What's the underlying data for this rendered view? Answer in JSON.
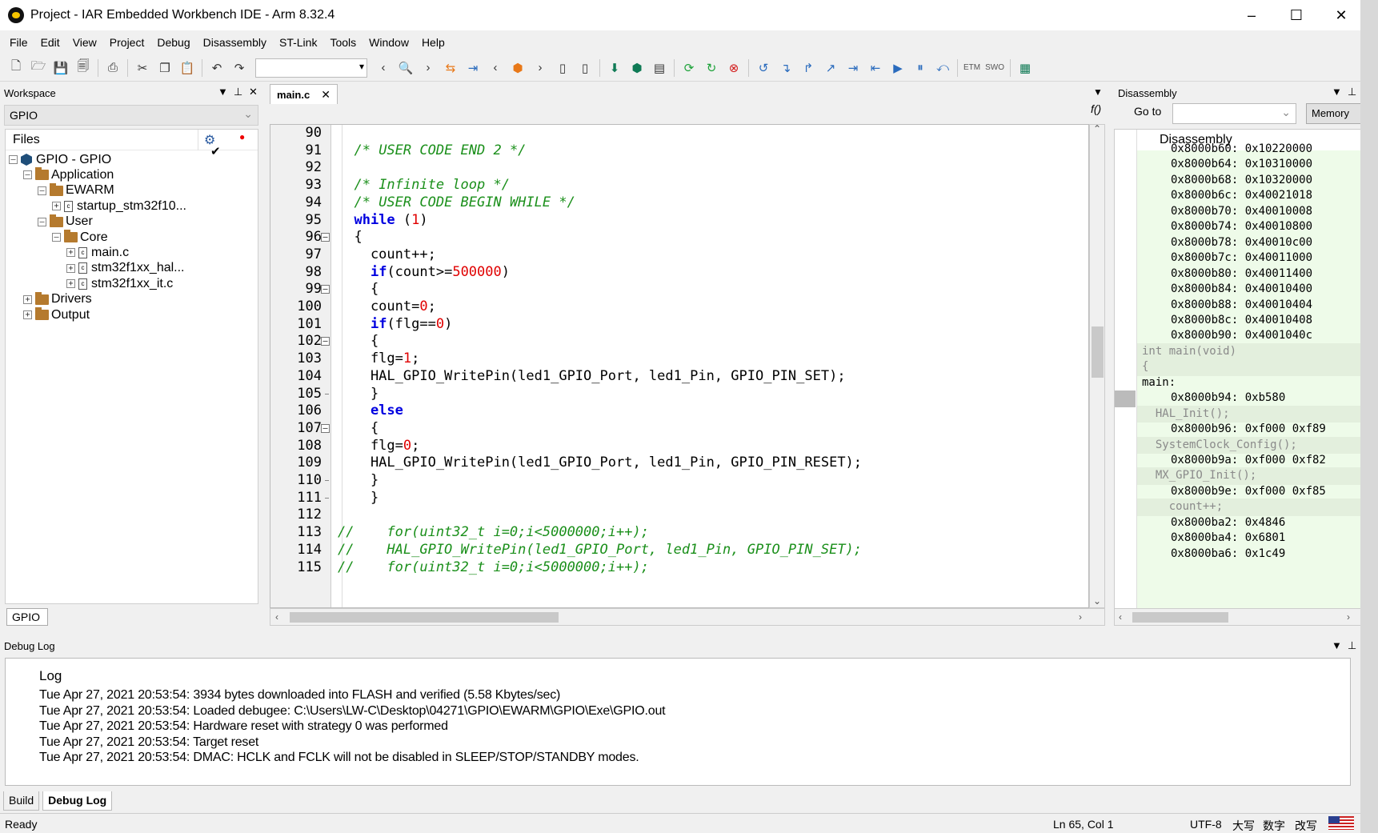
{
  "window": {
    "title": "Project - IAR Embedded Workbench IDE - Arm 8.32.4",
    "minimize": "–",
    "maximize": "☐",
    "close": "✕"
  },
  "menu": [
    "File",
    "Edit",
    "View",
    "Project",
    "Debug",
    "Disassembly",
    "ST-Link",
    "Tools",
    "Window",
    "Help"
  ],
  "toolbar": {
    "etm_label": "ETM",
    "swo_label": "SWO"
  },
  "workspace": {
    "header": "Workspace",
    "config": "GPIO",
    "files_header": "Files",
    "tree": [
      {
        "label": "GPIO - GPIO",
        "level": 0,
        "kind": "project",
        "expander": "–"
      },
      {
        "label": "Application",
        "level": 1,
        "kind": "folder",
        "expander": "–"
      },
      {
        "label": "EWARM",
        "level": 2,
        "kind": "folder",
        "expander": "–"
      },
      {
        "label": "startup_stm32f10...",
        "level": 3,
        "kind": "file",
        "expander": "+"
      },
      {
        "label": "User",
        "level": 2,
        "kind": "folder",
        "expander": "–"
      },
      {
        "label": "Core",
        "level": 3,
        "kind": "folder",
        "expander": "–"
      },
      {
        "label": "main.c",
        "level": 4,
        "kind": "file",
        "expander": "+"
      },
      {
        "label": "stm32f1xx_hal...",
        "level": 4,
        "kind": "file",
        "expander": "+"
      },
      {
        "label": "stm32f1xx_it.c",
        "level": 4,
        "kind": "file",
        "expander": "+"
      },
      {
        "label": "Drivers",
        "level": 1,
        "kind": "folder",
        "expander": "+"
      },
      {
        "label": "Output",
        "level": 1,
        "kind": "folder",
        "expander": "+"
      }
    ],
    "tab": "GPIO"
  },
  "editor": {
    "tab": "main.c",
    "fn_button": "f()",
    "lines": [
      {
        "n": "90",
        "fold": "",
        "parts": []
      },
      {
        "n": "91",
        "fold": "",
        "parts": [
          {
            "c": "",
            "t": "  "
          },
          {
            "c": "cm",
            "t": "/* USER CODE END 2 */"
          }
        ]
      },
      {
        "n": "92",
        "fold": "",
        "parts": []
      },
      {
        "n": "93",
        "fold": "",
        "parts": [
          {
            "c": "",
            "t": "  "
          },
          {
            "c": "cm",
            "t": "/* Infinite loop */"
          }
        ]
      },
      {
        "n": "94",
        "fold": "",
        "parts": [
          {
            "c": "",
            "t": "  "
          },
          {
            "c": "cm",
            "t": "/* USER CODE BEGIN WHILE */"
          }
        ]
      },
      {
        "n": "95",
        "fold": "",
        "parts": [
          {
            "c": "",
            "t": "  "
          },
          {
            "c": "kw",
            "t": "while"
          },
          {
            "c": "",
            "t": " ("
          },
          {
            "c": "nm",
            "t": "1"
          },
          {
            "c": "",
            "t": ")"
          }
        ]
      },
      {
        "n": "96",
        "fold": "box",
        "parts": [
          {
            "c": "",
            "t": "  {"
          }
        ]
      },
      {
        "n": "97",
        "fold": "",
        "parts": [
          {
            "c": "",
            "t": "    count++;"
          }
        ]
      },
      {
        "n": "98",
        "fold": "",
        "parts": [
          {
            "c": "",
            "t": "    "
          },
          {
            "c": "kw",
            "t": "if"
          },
          {
            "c": "",
            "t": "(count>="
          },
          {
            "c": "nm",
            "t": "500000"
          },
          {
            "c": "",
            "t": ")"
          }
        ]
      },
      {
        "n": "99",
        "fold": "box",
        "parts": [
          {
            "c": "",
            "t": "    {"
          }
        ]
      },
      {
        "n": "100",
        "fold": "",
        "parts": [
          {
            "c": "",
            "t": "    count="
          },
          {
            "c": "nm",
            "t": "0"
          },
          {
            "c": "",
            "t": ";"
          }
        ]
      },
      {
        "n": "101",
        "fold": "",
        "parts": [
          {
            "c": "",
            "t": "    "
          },
          {
            "c": "kw",
            "t": "if"
          },
          {
            "c": "",
            "t": "(flg=="
          },
          {
            "c": "nm",
            "t": "0"
          },
          {
            "c": "",
            "t": ")"
          }
        ]
      },
      {
        "n": "102",
        "fold": "box",
        "parts": [
          {
            "c": "",
            "t": "    {"
          }
        ]
      },
      {
        "n": "103",
        "fold": "",
        "parts": [
          {
            "c": "",
            "t": "    flg="
          },
          {
            "c": "nm",
            "t": "1"
          },
          {
            "c": "",
            "t": ";"
          }
        ]
      },
      {
        "n": "104",
        "fold": "",
        "parts": [
          {
            "c": "",
            "t": "    HAL_GPIO_WritePin(led1_GPIO_Port, led1_Pin, GPIO_PIN_SET);"
          }
        ]
      },
      {
        "n": "105",
        "fold": "tick",
        "parts": [
          {
            "c": "",
            "t": "    }"
          }
        ]
      },
      {
        "n": "106",
        "fold": "",
        "parts": [
          {
            "c": "",
            "t": "    "
          },
          {
            "c": "kw",
            "t": "else"
          }
        ]
      },
      {
        "n": "107",
        "fold": "box",
        "parts": [
          {
            "c": "",
            "t": "    {"
          }
        ]
      },
      {
        "n": "108",
        "fold": "",
        "parts": [
          {
            "c": "",
            "t": "    flg="
          },
          {
            "c": "nm",
            "t": "0"
          },
          {
            "c": "",
            "t": ";"
          }
        ]
      },
      {
        "n": "109",
        "fold": "",
        "parts": [
          {
            "c": "",
            "t": "    HAL_GPIO_WritePin(led1_GPIO_Port, led1_Pin, GPIO_PIN_RESET);"
          }
        ]
      },
      {
        "n": "110",
        "fold": "tick",
        "parts": [
          {
            "c": "",
            "t": "    }"
          }
        ]
      },
      {
        "n": "111",
        "fold": "tick",
        "parts": [
          {
            "c": "",
            "t": "    }"
          }
        ]
      },
      {
        "n": "112",
        "fold": "",
        "parts": []
      },
      {
        "n": "113",
        "fold": "",
        "parts": [
          {
            "c": "cm",
            "t": "//    for(uint32_t i=0;i<5000000;i++);"
          }
        ]
      },
      {
        "n": "114",
        "fold": "",
        "parts": [
          {
            "c": "cm",
            "t": "//    HAL_GPIO_WritePin(led1_GPIO_Port, led1_Pin, GPIO_PIN_SET);"
          }
        ]
      },
      {
        "n": "115",
        "fold": "",
        "parts": [
          {
            "c": "cm",
            "t": "//    for(uint32_t i=0;i<5000000;i++);"
          }
        ]
      }
    ]
  },
  "disassembly": {
    "header": "Disassembly",
    "goto_label": "Go to",
    "memory_button": "Memory",
    "title": "Disassembly",
    "lines": [
      {
        "kind": "addr",
        "t": "0x8000b60: 0x10220000"
      },
      {
        "kind": "addr",
        "t": "0x8000b64: 0x10310000"
      },
      {
        "kind": "addr",
        "t": "0x8000b68: 0x10320000"
      },
      {
        "kind": "addr",
        "t": "0x8000b6c: 0x40021018"
      },
      {
        "kind": "addr",
        "t": "0x8000b70: 0x40010008"
      },
      {
        "kind": "addr",
        "t": "0x8000b74: 0x40010800"
      },
      {
        "kind": "addr",
        "t": "0x8000b78: 0x40010c00"
      },
      {
        "kind": "addr",
        "t": "0x8000b7c: 0x40011000"
      },
      {
        "kind": "addr",
        "t": "0x8000b80: 0x40011400"
      },
      {
        "kind": "addr",
        "t": "0x8000b84: 0x40010400"
      },
      {
        "kind": "addr",
        "t": "0x8000b88: 0x40010404"
      },
      {
        "kind": "addr",
        "t": "0x8000b8c: 0x40010408"
      },
      {
        "kind": "addr",
        "t": "0x8000b90: 0x4001040c"
      },
      {
        "kind": "src",
        "t": "int main(void)"
      },
      {
        "kind": "src",
        "t": "{"
      },
      {
        "kind": "lbl",
        "t": "main:"
      },
      {
        "kind": "addr",
        "t": "0x8000b94: 0xb580"
      },
      {
        "kind": "src",
        "t": "  HAL_Init();"
      },
      {
        "kind": "addr",
        "t": "0x8000b96: 0xf000 0xf89"
      },
      {
        "kind": "src",
        "t": "  SystemClock_Config();"
      },
      {
        "kind": "addr",
        "t": "0x8000b9a: 0xf000 0xf82"
      },
      {
        "kind": "src",
        "t": "  MX_GPIO_Init();"
      },
      {
        "kind": "addr",
        "t": "0x8000b9e: 0xf000 0xf85"
      },
      {
        "kind": "src",
        "t": "    count++;"
      },
      {
        "kind": "addr",
        "t": "0x8000ba2: 0x4846"
      },
      {
        "kind": "addr",
        "t": "0x8000ba4: 0x6801"
      },
      {
        "kind": "addr",
        "t": "0x8000ba6: 0x1c49"
      }
    ]
  },
  "debuglog": {
    "header": "Debug Log",
    "column": "Log",
    "lines": [
      "Tue Apr 27, 2021 20:53:54: 3934 bytes downloaded into FLASH and verified (5.58 Kbytes/sec)",
      "Tue Apr 27, 2021 20:53:54: Loaded debugee: C:\\Users\\LW-C\\Desktop\\04271\\GPIO\\EWARM\\GPIO\\Exe\\GPIO.out",
      "Tue Apr 27, 2021 20:53:54: Hardware reset with strategy 0 was performed",
      "Tue Apr 27, 2021 20:53:54: Target reset",
      "Tue Apr 27, 2021 20:53:54: DMAC: HCLK and FCLK will not be disabled in SLEEP/STOP/STANDBY modes."
    ]
  },
  "bottom_tabs": [
    "Build",
    "Debug Log"
  ],
  "status": {
    "left": "Ready",
    "position": "Ln 65, Col 1",
    "encoding": "UTF-8",
    "caps": "大写",
    "num": "数字",
    "ovr": "改写"
  }
}
